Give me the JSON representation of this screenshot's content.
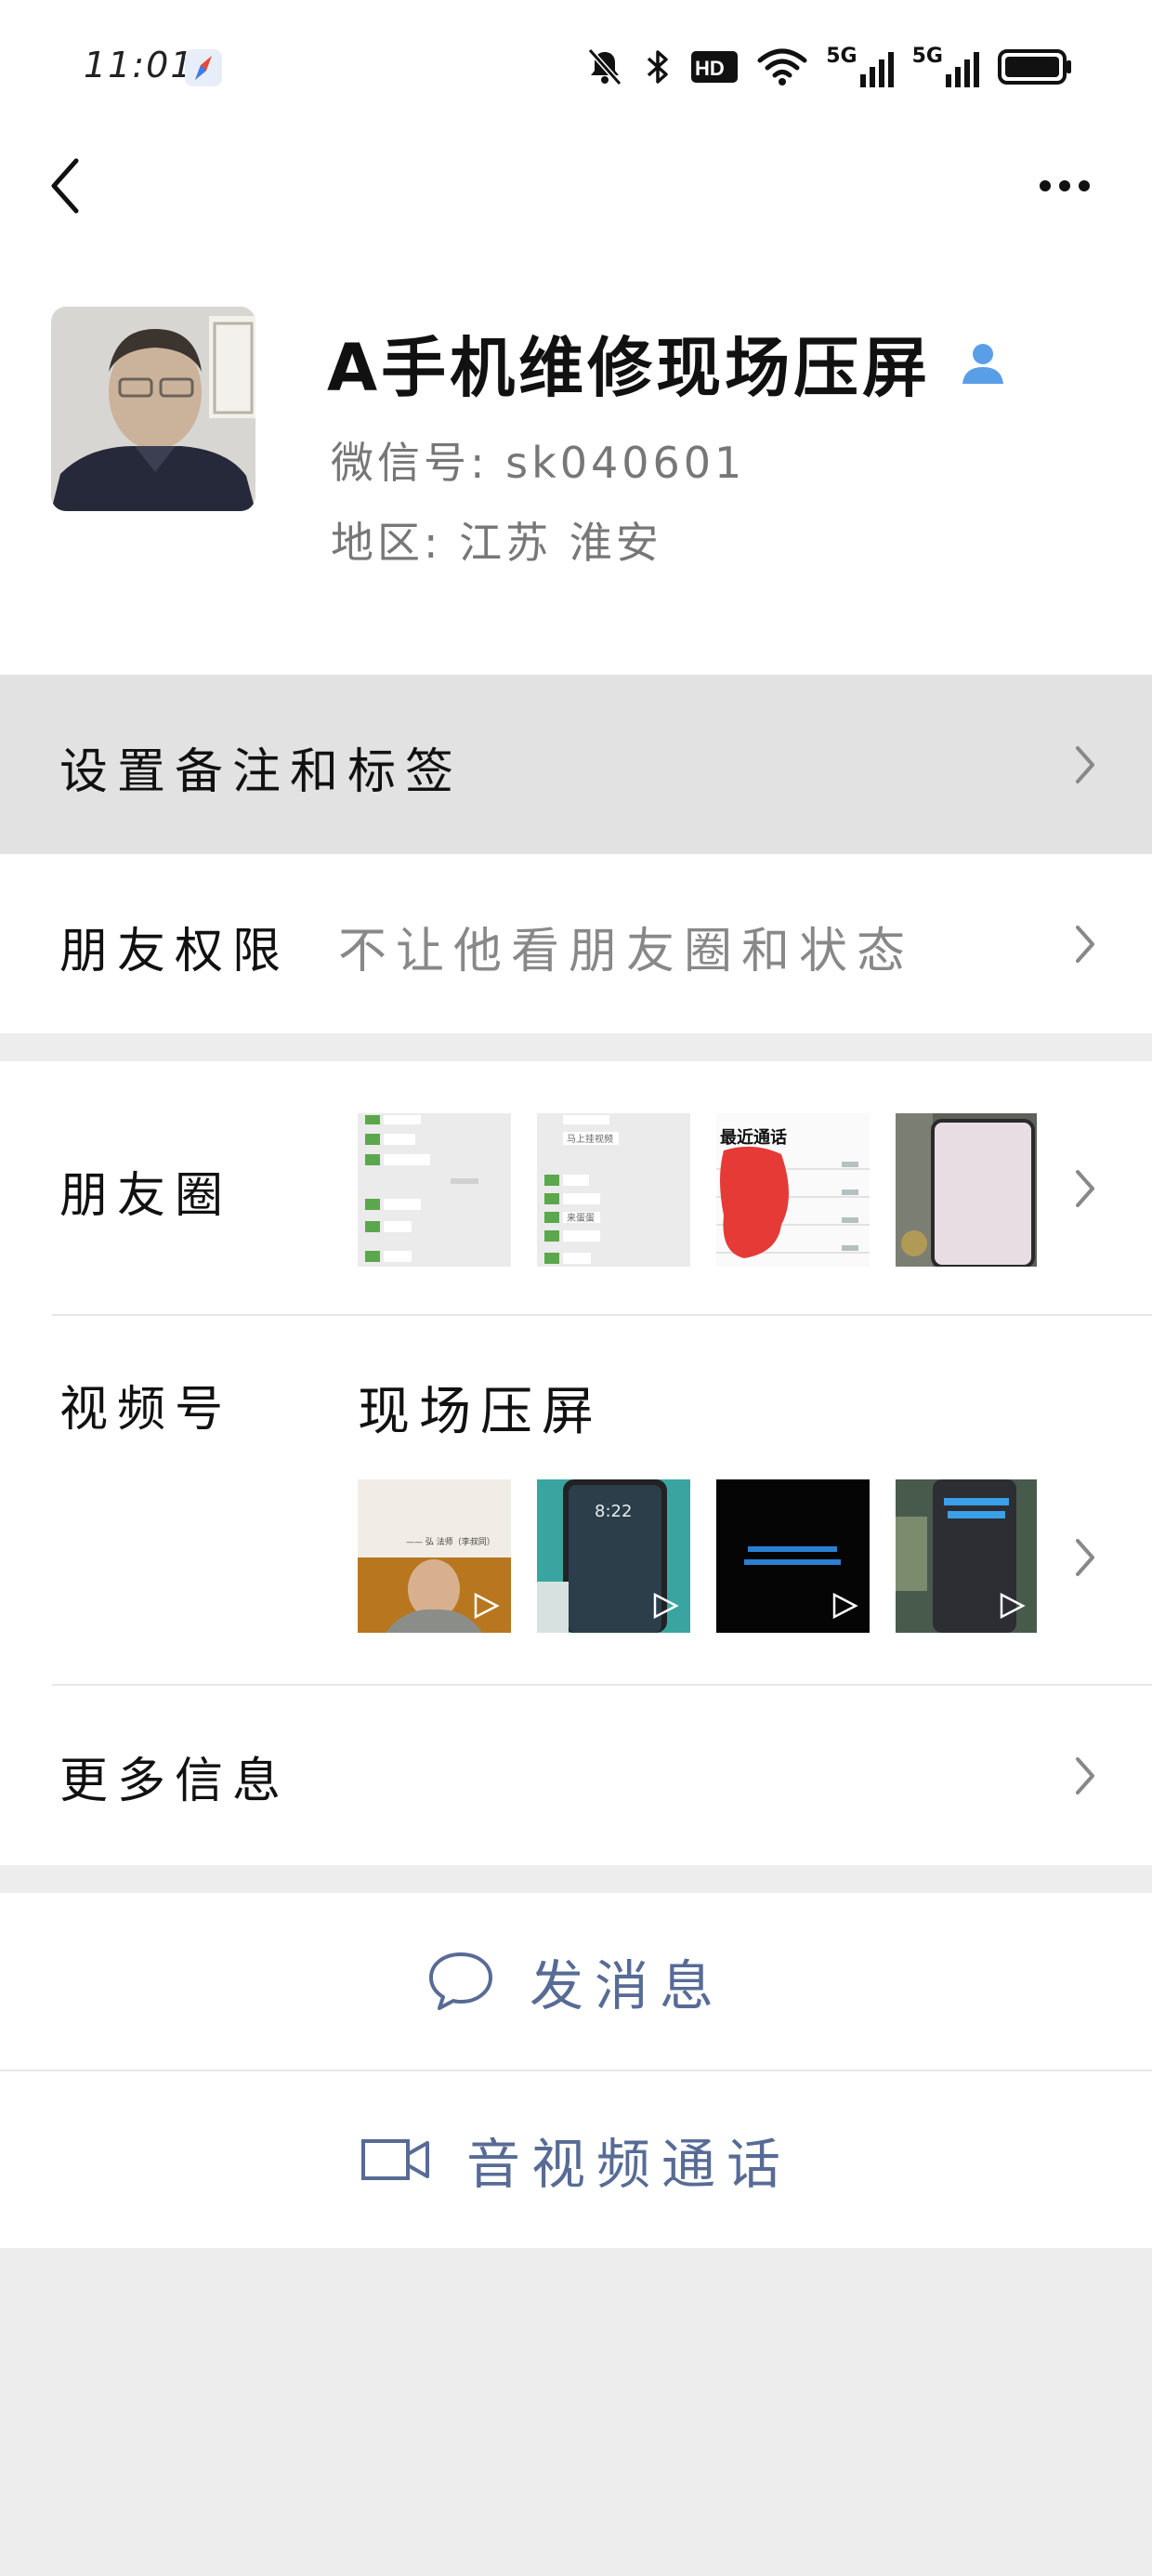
{
  "status_bar": {
    "time": "11:01",
    "icons": [
      "compass-app-icon",
      "mute-icon",
      "bluetooth-icon",
      "hd-icon",
      "wifi-icon",
      "signal-5g-icon",
      "signal-5g-icon",
      "battery-icon"
    ],
    "hd_label": "HD",
    "network_1": "5G",
    "network_2": "5G"
  },
  "nav": {
    "back_icon": "chevron-left-icon",
    "more_icon": "more-dots-icon"
  },
  "profile": {
    "nickname": "A手机维修现场压屏",
    "wechat_id": "微信号: sk040601",
    "region": "地区: 江苏 淮安"
  },
  "rows": {
    "remark": {
      "label": "设置备注和标签"
    },
    "permissions": {
      "label": "朋友权限",
      "value": "不让他看朋友圈和状态"
    },
    "moments": {
      "label": "朋友圈"
    },
    "channels": {
      "label": "视频号",
      "value": "现场压屏"
    },
    "more_info": {
      "label": "更多信息"
    }
  },
  "moments_thumb_texts": [
    "最近通话",
    "马上挂视频",
    "来蛋蛋"
  ],
  "channel_thumb_texts": [
    "—— 弘 法师（李叔同）",
    "8:22"
  ],
  "actions": {
    "send_message": "发消息",
    "video_call": "音视频通话"
  },
  "colors": {
    "link_blue": "#576b95",
    "page_bg": "#ededed",
    "pressed_row_bg": "#e2e2e2",
    "verified_badge": "#5b9ee8"
  }
}
